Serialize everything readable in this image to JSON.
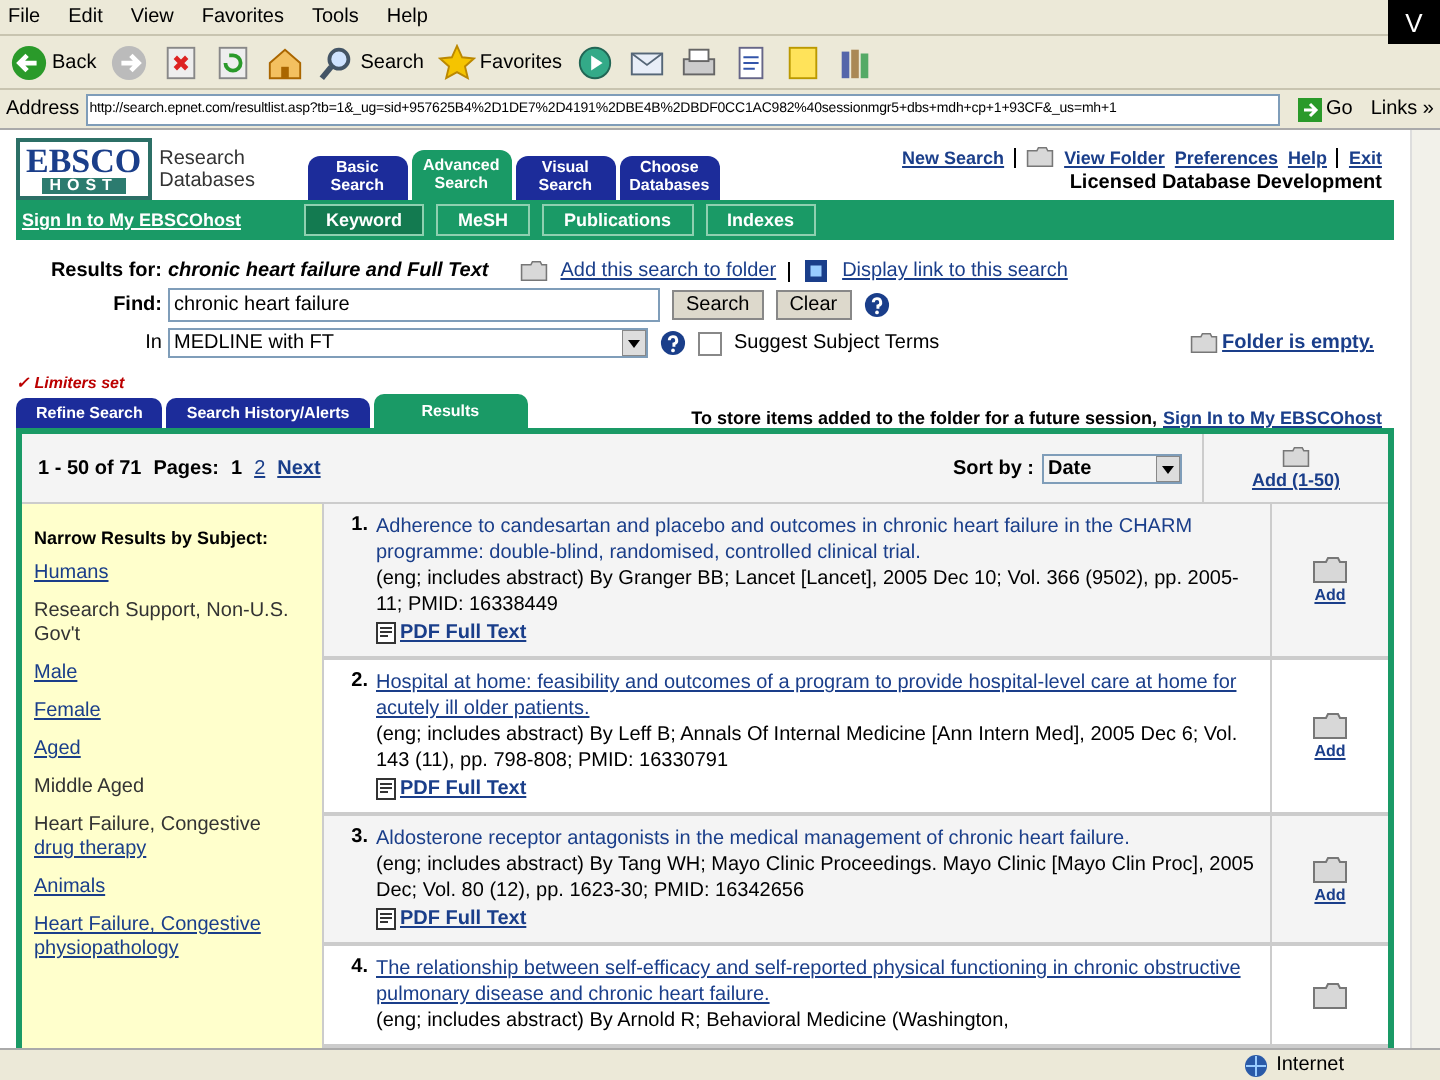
{
  "browser": {
    "menu": [
      "File",
      "Edit",
      "View",
      "Favorites",
      "Tools",
      "Help"
    ],
    "toolbar": [
      {
        "kind": "back",
        "label": "Back"
      },
      {
        "kind": "forward"
      },
      {
        "kind": "stop"
      },
      {
        "kind": "refresh"
      },
      {
        "kind": "home"
      },
      {
        "kind": "search",
        "label": "Search"
      },
      {
        "kind": "favorites",
        "label": "Favorites"
      },
      {
        "kind": "media"
      },
      {
        "kind": "mail"
      },
      {
        "kind": "print"
      },
      {
        "kind": "word"
      },
      {
        "kind": "note"
      },
      {
        "kind": "research"
      }
    ],
    "address_label": "Address",
    "address": "http://search.epnet.com/resultlist.asp?tb=1&_ug=sid+957625B4%2D1DE7%2D4191%2DBE4B%2DBDF0CC1AC982%40sessionmgr5+dbs+mdh+cp+1+93CF&_us=mh+1",
    "go": "Go",
    "links": "Links »",
    "corner": "V"
  },
  "header": {
    "logo_top": "EBSCO",
    "logo_bottom": "HOST",
    "logo_caption": "Research Databases",
    "sign_in": "Sign In to My EBSCOhost",
    "tabs": [
      {
        "label": "Basic Search",
        "selected": false
      },
      {
        "label": "Advanced Search",
        "selected": true
      },
      {
        "label": "Visual Search",
        "selected": false
      },
      {
        "label": "Choose Databases",
        "selected": false
      }
    ],
    "subtabs": [
      {
        "label": "Keyword",
        "selected": true
      },
      {
        "label": "MeSH",
        "selected": false
      },
      {
        "label": "Publications",
        "selected": false
      },
      {
        "label": "Indexes",
        "selected": false
      }
    ],
    "links": [
      "New Search",
      "View Folder",
      "Preferences",
      "Help",
      "Exit"
    ],
    "org": "Licensed Database Development"
  },
  "search": {
    "results_for_label": "Results for:",
    "results_for": "chronic heart failure and Full Text",
    "add_search": "Add this search to folder",
    "display_link": "Display link to this search",
    "find_label": "Find:",
    "find_value": "chronic heart failure",
    "search_button": "Search",
    "clear_button": "Clear",
    "in_label": "In",
    "database": "MEDLINE with FT",
    "suggest": {
      "label": "Suggest Subject Terms",
      "checked": false
    },
    "folder": "Folder is empty."
  },
  "limiters": "✓ Limiters set",
  "result_tabs": [
    {
      "label": "Refine Search",
      "selected": false
    },
    {
      "label": "Search History/Alerts",
      "selected": false
    },
    {
      "label": "Results",
      "selected": true
    }
  ],
  "store_note": "To store items added to the folder for a future session,",
  "store_link": "Sign In to My EBSCOhost",
  "results": {
    "range": "1 - 50 of 71",
    "pages_label": "Pages:",
    "pages": [
      {
        "label": "1",
        "selected": true
      },
      {
        "label": "2",
        "selected": false
      }
    ],
    "next": "Next",
    "sort_label": "Sort by :",
    "sort_value": "Date",
    "add_all": "Add (1-50)",
    "narrow_title": "Narrow Results by Subject:",
    "subjects": [
      {
        "label": "Humans",
        "linked": true
      },
      {
        "label": "Research Support, Non-U.S. Gov't",
        "linked": false
      },
      {
        "label": "Male",
        "linked": true
      },
      {
        "label": "Female",
        "linked": true
      },
      {
        "label": "Aged",
        "linked": true
      },
      {
        "label": "Middle Aged",
        "linked": false
      },
      {
        "label": "Heart Failure, Congestive",
        "linked": false,
        "sub": "drug therapy"
      },
      {
        "label": "Animals",
        "linked": true
      },
      {
        "label": "Heart Failure, Congestive",
        "linked": true,
        "sub": "physiopathology"
      }
    ],
    "items": [
      {
        "number": "1.",
        "title": "Adherence to candesartan and placebo and outcomes in chronic heart failure in the CHARM programme: double-blind, randomised, controlled clinical trial.",
        "details": "(eng; includes abstract) By Granger BB; Lancet [Lancet], 2005 Dec 10; Vol. 366 (9502), pp. 2005-11; PMID: 16338449",
        "pdf": "PDF Full Text",
        "add": "Add",
        "underlined": false
      },
      {
        "number": "2.",
        "title": "Hospital at home: feasibility and outcomes of a program to provide hospital-level care at home for acutely ill older patients.",
        "details": "(eng; includes abstract) By Leff B; Annals Of Internal Medicine [Ann Intern Med], 2005 Dec 6; Vol. 143 (11), pp. 798-808; PMID: 16330791",
        "pdf": "PDF Full Text",
        "add": "Add",
        "underlined": true
      },
      {
        "number": "3.",
        "title": "Aldosterone receptor antagonists in the medical management of chronic heart failure.",
        "details": "(eng; includes abstract) By Tang WH; Mayo Clinic Proceedings. Mayo Clinic [Mayo Clin Proc], 2005 Dec; Vol. 80 (12), pp. 1623-30; PMID: 16342656",
        "pdf": "PDF Full Text",
        "add": "Add",
        "underlined": false
      },
      {
        "number": "4.",
        "title": "The relationship between self-efficacy and self-reported physical functioning in chronic obstructive pulmonary disease and chronic heart failure.",
        "details": "(eng; includes abstract) By Arnold R; Behavioral Medicine (Washington,",
        "underlined": true
      }
    ]
  },
  "status": {
    "zone": "Internet"
  }
}
